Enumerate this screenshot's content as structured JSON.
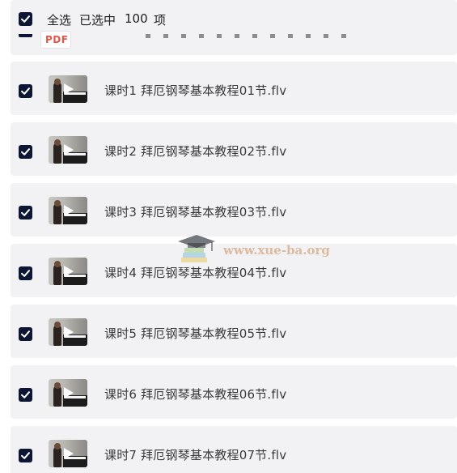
{
  "header": {
    "select_all_label": "全选",
    "selected_label": "已选中",
    "selected_count": "100",
    "unit_label": "项"
  },
  "partial_item": {
    "badge": "PDF"
  },
  "items": [
    {
      "title": "课时1 拜厄钢琴基本教程01节.flv",
      "checked": true
    },
    {
      "title": "课时2 拜厄钢琴基本教程02节.flv",
      "checked": true
    },
    {
      "title": "课时3 拜厄钢琴基本教程03节.flv",
      "checked": true
    },
    {
      "title": "课时4 拜厄钢琴基本教程04节.flv",
      "checked": true
    },
    {
      "title": "课时5 拜厄钢琴基本教程05节.flv",
      "checked": true
    },
    {
      "title": "课时6 拜厄钢琴基本教程06节.flv",
      "checked": true
    },
    {
      "title": "课时7 拜厄钢琴基本教程07节.flv",
      "checked": true
    }
  ],
  "watermark": {
    "text": "www.xue-ba.org"
  },
  "colors": {
    "checkbox": "#0d1633",
    "row_background": "#f2f2f4",
    "text": "#3a3a3a",
    "pdf_badge": "#e2574c"
  },
  "icons": {
    "checkbox": "checkmark-icon",
    "thumbnail_overlay": "play-icon",
    "file_type": "pdf-icon",
    "watermark": "graduation-cap-icon"
  }
}
